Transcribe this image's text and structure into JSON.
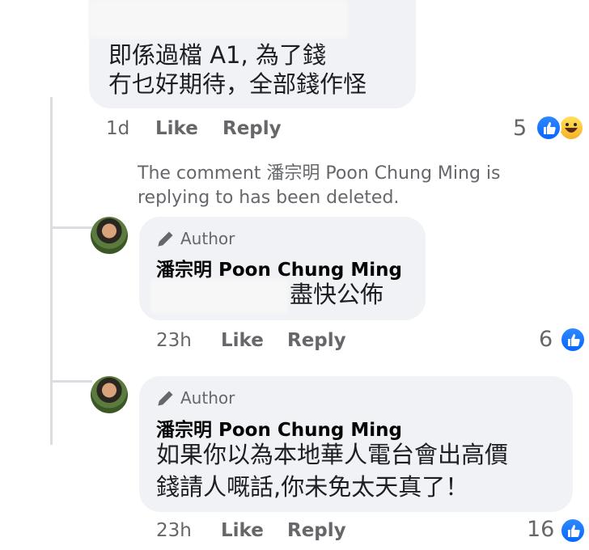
{
  "comment_1": {
    "lines": [
      "即係過檔 A1, 為了錢",
      "冇乜好期待，全部錢作怪"
    ],
    "time": "1d",
    "like_label": "Like",
    "reply_label": "Reply",
    "reaction_count": "5",
    "reactions": [
      "like-icon",
      "haha-icon"
    ]
  },
  "deleted_notice": {
    "line1": "The comment 潘宗明 Poon Chung Ming is",
    "line2": "replying to has been deleted."
  },
  "reply_1": {
    "badge": "Author",
    "author": "潘宗明 Poon Chung Ming",
    "text": "盡快公佈",
    "time": "23h",
    "like_label": "Like",
    "reply_label": "Reply",
    "reaction_count": "6",
    "reactions": [
      "like-icon"
    ]
  },
  "reply_2": {
    "badge": "Author",
    "author": "潘宗明 Poon Chung Ming",
    "lines": [
      "如果你以為本地華人電台會出高價",
      "錢請人嘅話,你未免太天真了！"
    ],
    "time": "23h",
    "like_label": "Like",
    "reply_label": "Reply",
    "reaction_count": "16",
    "reactions": [
      "like-icon"
    ]
  },
  "colors": {
    "bubble": "#f0f2f5",
    "meta_text": "#65676b",
    "like_blue": "#0866ff",
    "haha_yellow": "#f7b125"
  }
}
